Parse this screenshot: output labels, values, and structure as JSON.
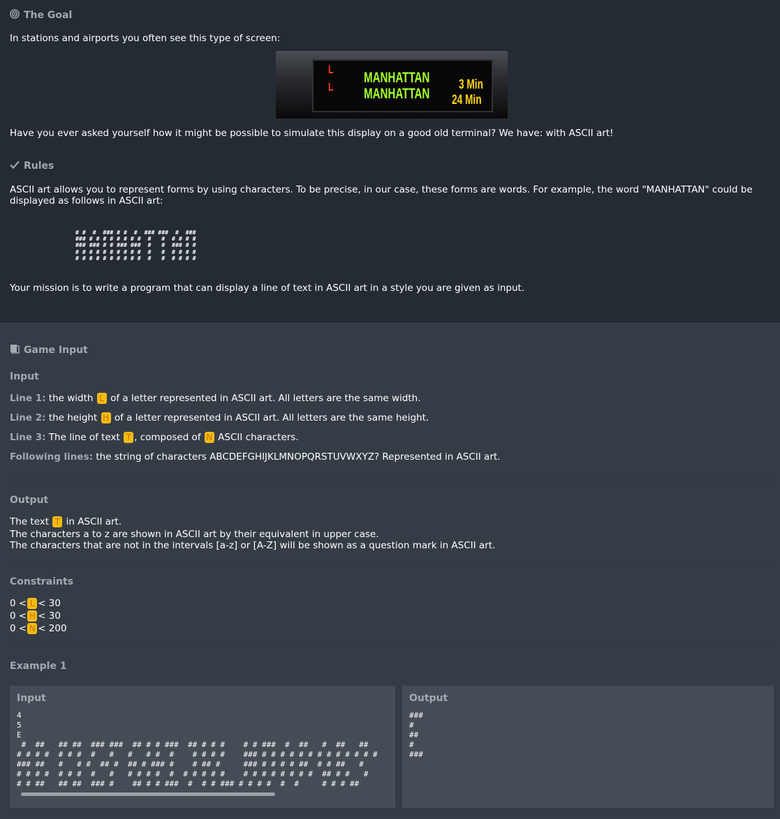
{
  "goal": {
    "title": "The Goal",
    "intro": "In stations and airports you often see this type of screen:",
    "banner": {
      "line1_letter": "L",
      "line2_letter": "L",
      "line1_dest": "MANHATTAN",
      "line2_dest": "MANHATTAN",
      "line1_time": "3 Min",
      "line2_time": "24 Min"
    },
    "question": "Have you ever asked yourself how it might be possible to simulate this display on a good old terminal? We have: with ASCII art!"
  },
  "rules": {
    "title": "Rules",
    "text": "ASCII art allows you to represent forms by using characters. To be precise, in our case, these forms are words. For example, the word \"MANHATTAN\" could be displayed as follows in ASCII art:",
    "art": "# #  #  ### # #  #  ### ###  #  ###\n### # # # # # # # #  #   #  # # # #\n### ### # # ### ###  #   #  ### # #\n# # # # # # # # # #  #   #  # # # #\n# # # # # # # # # #  #   #  # # # #",
    "mission": "Your mission is to write a program that can display a line of text in ASCII art in a style you are given as input."
  },
  "game_input": {
    "title": "Game Input",
    "input_heading": "Input",
    "line1_label": "Line 1:",
    "line1_pre": "the width",
    "line1_var": "L",
    "line1_post": "of a letter represented in ASCII art. All letters are the same width.",
    "line2_label": "Line 2:",
    "line2_pre": "the height",
    "line2_var": "H",
    "line2_post": "of a letter represented in ASCII art. All letters are the same height.",
    "line3_label": "Line 3:",
    "line3_pre": "The line of text",
    "line3_var1": "T",
    "line3_mid": ", composed of",
    "line3_var2": "N",
    "line3_post": "ASCII characters.",
    "following_label": "Following lines:",
    "following_text": "the string of characters ABCDEFGHIJKLMNOPQRSTUVWXYZ? Represented in ASCII art.",
    "output_heading": "Output",
    "out1_pre": "The text",
    "out1_var": "T",
    "out1_post": "in ASCII art.",
    "out2": "The characters a to z are shown in ASCII art by their equivalent in upper case.",
    "out3": "The characters that are not in the intervals [a-z] or [A-Z] will be shown as a question mark in ASCII art.",
    "constraints_heading": "Constraints",
    "c1_pre": "0 <",
    "c1_var": "L",
    "c1_post": "< 30",
    "c2_pre": "0 <",
    "c2_var": "H",
    "c2_post": "< 30",
    "c3_pre": "0 <",
    "c3_var": "N",
    "c3_post": "< 200"
  },
  "example": {
    "title": "Example 1",
    "input_label": "Input",
    "input_text": "4\n5\nE\n #  ##   ## ##  ### ###  ## # # ###  ## # # #    # # ###  #  ##   #  ##   ##\n# # # #  # # #  #   #   #   # #  #    # # # #    ### # # # # # # # # # # # # #\n### ##   #   # #  ## #  ## # ### #    # ## #     ### # # # # ##  # # ##   #\n# # # #  # # #  #   #   # # # #  #  # # # # #    # # # # # # # #  ## # #   #\n# # ##   ## ##  ### #    ## # # ###  #  # # ### # # # #  #  #     # # # ##",
    "output_label": "Output",
    "output_text": "###\n#\n##\n#\n###"
  }
}
